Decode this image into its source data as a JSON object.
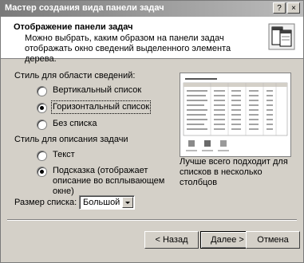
{
  "window": {
    "title": "Мастер создания вида панели задач",
    "help_btn": "?",
    "close_btn": "×"
  },
  "header": {
    "title": "Отображение панели задач",
    "description": "Можно выбрать, каким образом на панели задач отображать окно сведений выделенного элемента дерева."
  },
  "details_style": {
    "label": "Стиль для области сведений:",
    "options": [
      {
        "label": "Вертикальный список",
        "selected": false
      },
      {
        "label": "Горизонтальный список",
        "selected": true
      },
      {
        "label": "Без списка",
        "selected": false
      }
    ]
  },
  "task_style": {
    "label": "Стиль для описания задачи",
    "options": [
      {
        "label": "Текст",
        "selected": false
      },
      {
        "label": "Подсказка (отображает описание во всплывающем окне)",
        "selected": true
      }
    ]
  },
  "list_size": {
    "label": "Размер списка:",
    "value": "Большой"
  },
  "preview_caption": "Лучше всего подходит для списков в несколько столбцов",
  "buttons": {
    "back": "< Назад",
    "next": "Далее >",
    "cancel": "Отмена"
  }
}
